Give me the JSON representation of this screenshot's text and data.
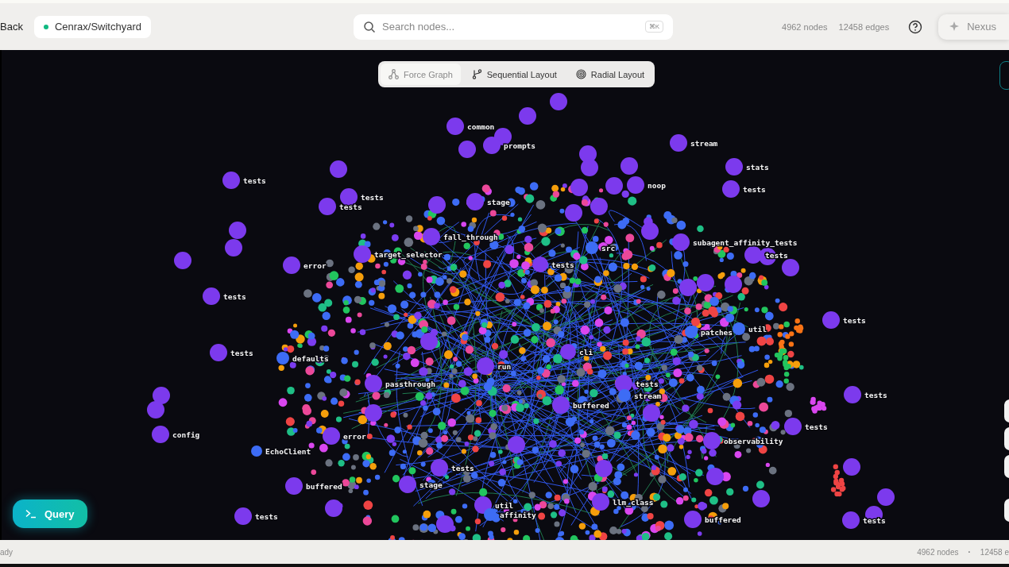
{
  "topbar": {
    "back": "Back",
    "repo": "Cenrax/Switchyard",
    "search": {
      "placeholder": "Search nodes...",
      "shortcut": "⌘K"
    },
    "stats": [
      "4962 nodes",
      "12458 edges"
    ],
    "assistant": "Nexus"
  },
  "layouts": [
    {
      "label": "Force Graph",
      "selected": true,
      "kind": "force"
    },
    {
      "label": "Sequential Layout",
      "selected": false,
      "kind": "sequential"
    },
    {
      "label": "Radial Layout",
      "selected": false,
      "kind": "radial"
    }
  ],
  "graph": {
    "labels": [
      "common",
      "prompts",
      "stream",
      "stats",
      "tests",
      "noop",
      "tests",
      "tests",
      "tests",
      "stage",
      "fall_through",
      "subagent_affinity_tests",
      "src",
      "target_selector",
      "tests",
      "tests",
      "error",
      "tests",
      "tests",
      "patches",
      "util",
      "tests",
      "defaults",
      "cli",
      "run",
      "passthrough",
      "tests",
      "stream",
      "buffered",
      "tests",
      "config",
      "tests",
      "error",
      "observability",
      "EchoClient",
      "buffered",
      "stage",
      "tests",
      "util",
      "affinity",
      "llm_class",
      "tests",
      "buffered",
      "tests"
    ]
  },
  "query_button": "Query",
  "status_bar": {
    "status": "ady",
    "nodes": "4962 nodes",
    "separator": "·",
    "edges": "12458 e"
  }
}
